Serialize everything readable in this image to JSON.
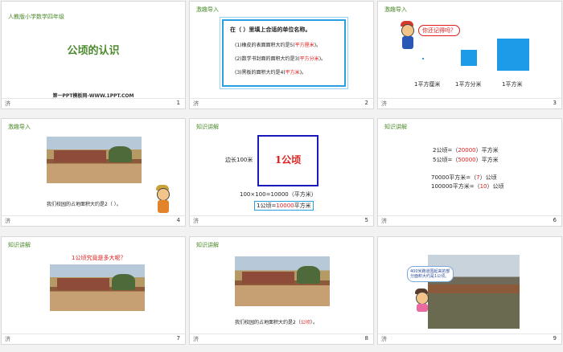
{
  "colors": {
    "green": "#4a8a2a",
    "red": "#e21c1c",
    "blue": "#2a9fe2",
    "navy": "#1a1ab8"
  },
  "slides": [
    {
      "page": "1",
      "mark": "济",
      "grade": "人教版小学数学四年级",
      "title": "公顷的认识",
      "footer": "第一PPT模板网-WWW.1PPT.COM"
    },
    {
      "page": "2",
      "mark": "济",
      "heading": "激趣导入",
      "instruction": "在（ ）里填上合适的单位名称。",
      "line1_pre": "(1)橡皮的表面面积大约是5(",
      "line1_ans": "平方厘米",
      "line1_post": ")。",
      "line2_pre": "(2)数学书封面的面积大约是3(",
      "line2_ans": "平方分米",
      "line2_post": ")。",
      "line3_pre": "(3)黑板的面积大约是4(",
      "line3_ans": "平方米",
      "line3_post": ")。"
    },
    {
      "page": "3",
      "mark": "济",
      "heading": "激趣导入",
      "bubble": "你还记得吗？",
      "label_cm": "1平方厘米",
      "label_dm": "1平方分米",
      "label_m": "1平方米"
    },
    {
      "page": "4",
      "mark": "济",
      "heading": "激趣导入",
      "text": "我们校园的占地面积大约是2（    ）。"
    },
    {
      "page": "5",
      "mark": "济",
      "heading": "知识讲解",
      "side": "边长100米",
      "box": "1公顷",
      "calc": "100×100=10000（平方米）",
      "eq_pre": "1公顷=",
      "eq_ans": "10000",
      "eq_post": "平方米"
    },
    {
      "page": "6",
      "mark": "济",
      "heading": "知识讲解",
      "r1_pre": "2公顷=（",
      "r1_ans": "20000",
      "r1_post": "）平方米",
      "r2_pre": "5公顷=（",
      "r2_ans": "50000",
      "r2_post": "）平方米",
      "r3_pre": "70000平方米=（",
      "r3_ans": "7",
      "r3_post": "）公顷",
      "r4_pre": "100000平方米=（",
      "r4_ans": "10",
      "r4_post": "）公顷"
    },
    {
      "page": "7",
      "mark": "济",
      "heading": "知识讲解",
      "question": "1公顷究竟是多大呢？"
    },
    {
      "page": "8",
      "mark": "济",
      "heading": "知识讲解",
      "text_pre": "我们校园的占地面积大约是2（",
      "text_ans": "公顷",
      "text_post": "）。"
    },
    {
      "page": "9",
      "mark": "济",
      "bubble": "400米跑道围起来的部分面积大约是1公顷。"
    }
  ]
}
